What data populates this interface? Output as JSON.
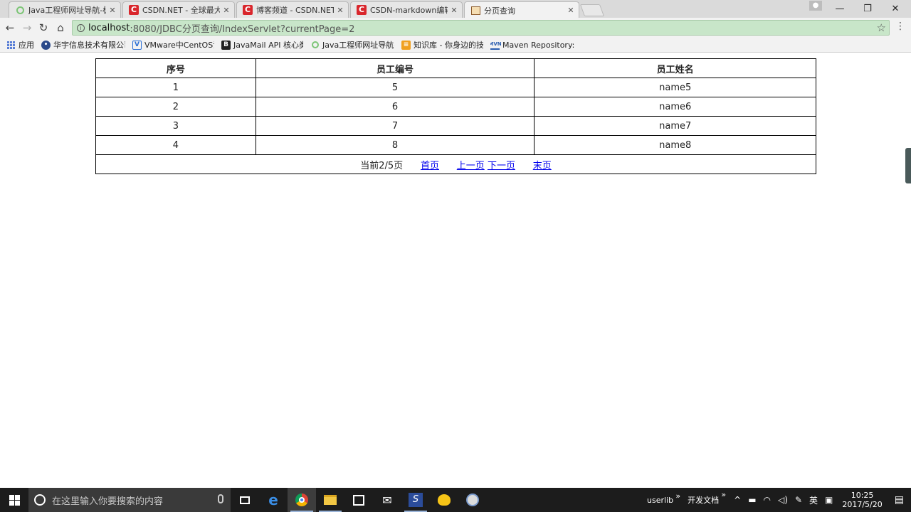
{
  "browser": {
    "tabs": [
      {
        "title": "Java工程师网址导航-极客",
        "icon": "circle-favicon-icon",
        "active": false
      },
      {
        "title": "CSDN.NET - 全球最大中",
        "icon": "csdn-favicon-icon",
        "active": false
      },
      {
        "title": "博客频道 - CSDN.NET",
        "icon": "csdn-favicon-icon",
        "active": false
      },
      {
        "title": "CSDN-markdown编辑器",
        "icon": "csdn-favicon-icon",
        "active": false
      },
      {
        "title": "分页查询",
        "icon": "page-favicon-icon",
        "active": true
      }
    ],
    "url_host": "localhost",
    "url_rest": ":8080/JDBC分页查询/IndexServlet?currentPage=2",
    "bookmarks": [
      {
        "label": "应用",
        "icon": "apps-grid-icon"
      },
      {
        "label": "华宇信息技术有限公司",
        "icon": "globe-icon"
      },
      {
        "label": "VMware中CentOS设",
        "icon": "vmware-icon"
      },
      {
        "label": "JavaMail API 核心类",
        "icon": "b-icon"
      },
      {
        "label": "Java工程师网址导航-",
        "icon": "circle-favicon-icon"
      },
      {
        "label": "知识库 - 你身边的技术",
        "icon": "book-icon"
      },
      {
        "label": "Maven Repository: S",
        "icon": "mvn-icon"
      }
    ]
  },
  "table": {
    "headers": [
      "序号",
      "员工编号",
      "员工姓名"
    ],
    "rows": [
      [
        "1",
        "5",
        "name5"
      ],
      [
        "2",
        "6",
        "name6"
      ],
      [
        "3",
        "7",
        "name7"
      ],
      [
        "4",
        "8",
        "name8"
      ]
    ],
    "pager": {
      "current_text": "当前2/5页",
      "first": "首页",
      "prev": "上一页",
      "next": "下一页",
      "last": "末页"
    }
  },
  "taskbar": {
    "search_placeholder": "在这里输入你要搜索的内容",
    "tray_label_1": "userlib",
    "tray_label_2": "开发文档",
    "ime": "英",
    "time": "10:25",
    "date": "2017/5/20"
  }
}
